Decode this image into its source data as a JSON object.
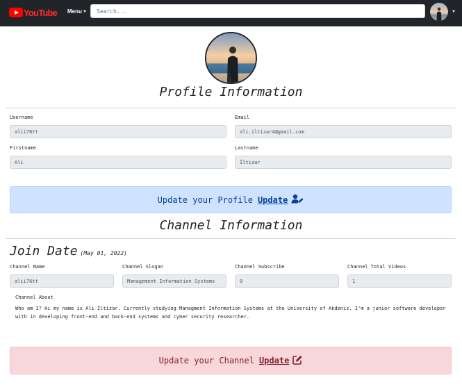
{
  "navbar": {
    "logo_text": "YouTube",
    "menu_label": "Menu",
    "search_placeholder": "Search...",
    "brand_color": "#ff0000"
  },
  "profile": {
    "title": "Profile Information",
    "username_label": "Username",
    "username_value": "alii76tt",
    "email_label": "Email",
    "email_value": "ali.iltizar4@gmail.com",
    "firstname_label": "Firstname",
    "firstname_value": "Ali",
    "lastname_label": "Lastname",
    "lastname_value": "İltizar",
    "update_text": "Update your Profile",
    "update_link": "Update",
    "update_icon": "user-edit-icon"
  },
  "channel": {
    "title": "Channel Information",
    "join_label": "Join Date",
    "join_date": "(May 01, 2022)",
    "name_label": "Channel Name",
    "name_value": "alii76tt",
    "slogan_label": "Channel Slogan",
    "slogan_value": "Management Information Systems",
    "subscribe_label": "Channel Subscribe",
    "subscribe_value": "0",
    "videos_label": "Channel Total Videos",
    "videos_value": "1",
    "about_label": "Channel About",
    "about_text": "Who am I? Hi my name is Ali İltizar. Currently studying Managment Information Systems at the University of Akdeniz. I'm a junior software developer with in developing front-end and back-end systems and cyber security researcher.",
    "update_text": "Update your Channel",
    "update_link": "Update",
    "update_icon": "edit-icon"
  }
}
